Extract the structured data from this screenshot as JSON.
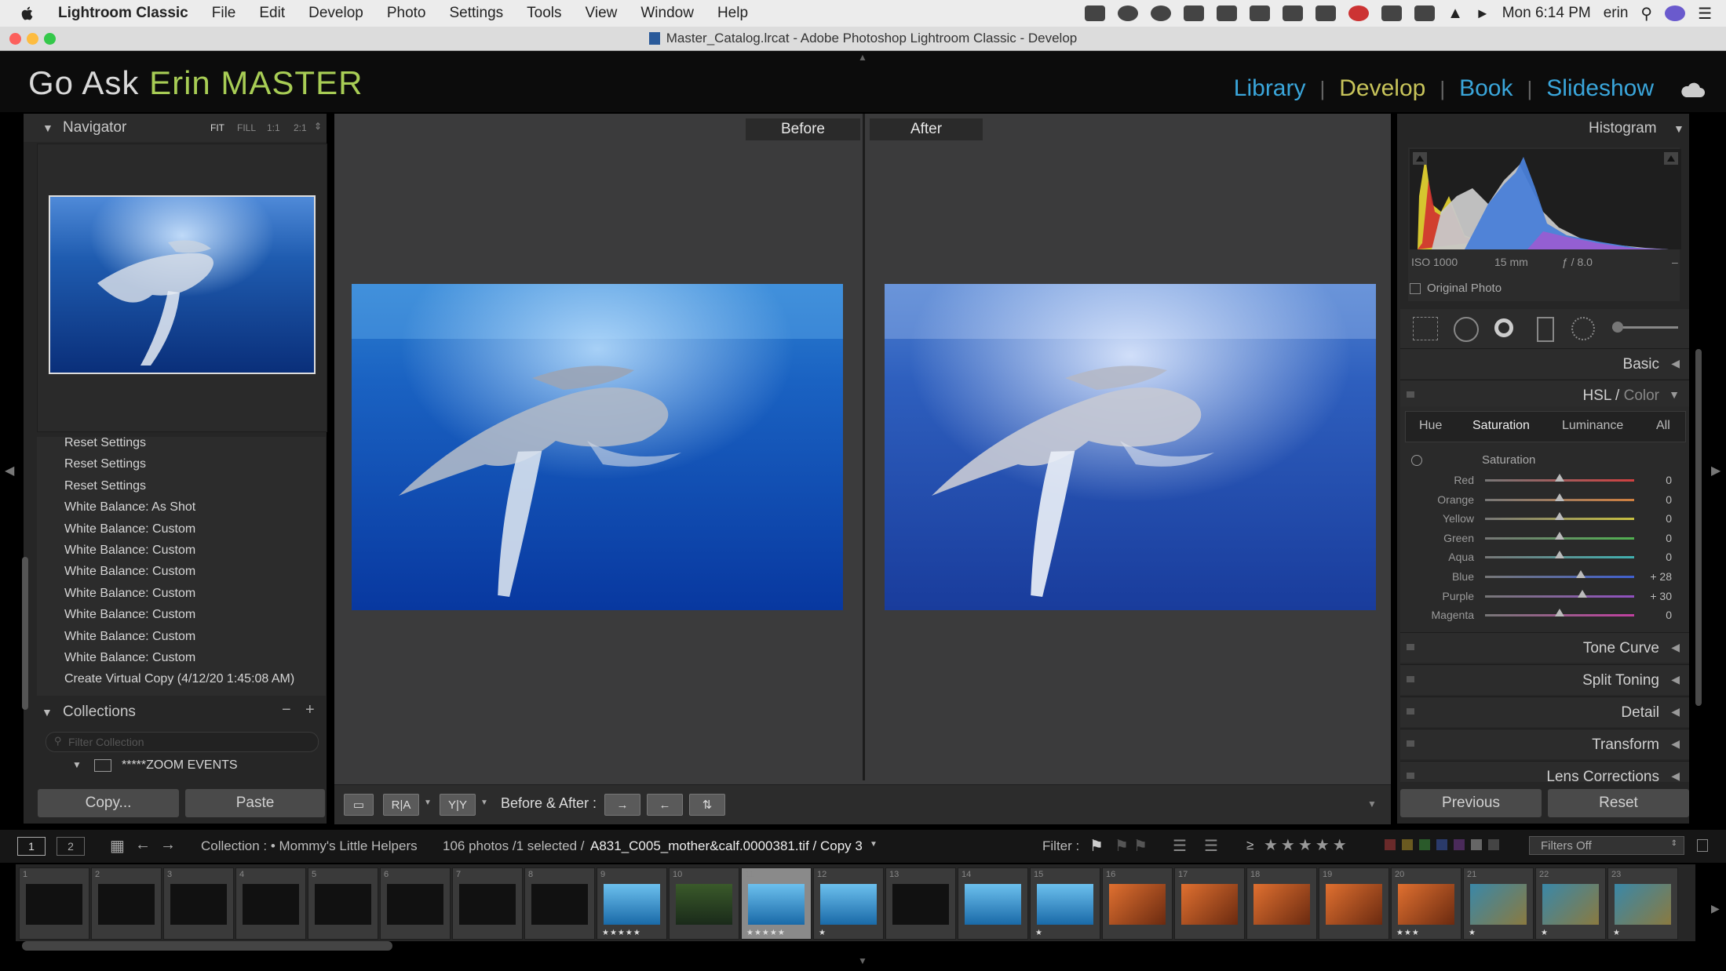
{
  "menubar": {
    "items": [
      "Lightroom Classic",
      "File",
      "Edit",
      "Develop",
      "Photo",
      "Settings",
      "Tools",
      "View",
      "Window",
      "Help"
    ],
    "clock": "Mon 6:14 PM",
    "user": "erin"
  },
  "window": {
    "title": "Master_Catalog.lrcat - Adobe Photoshop Lightroom Classic - Develop"
  },
  "identity": {
    "part1": "Go Ask ",
    "part2": "Erin MASTER"
  },
  "modules": [
    {
      "label": "Library",
      "active": false
    },
    {
      "label": "Develop",
      "active": true
    },
    {
      "label": "Book",
      "active": false
    },
    {
      "label": "Slideshow",
      "active": false
    }
  ],
  "navigator": {
    "title": "Navigator",
    "zoom": [
      "FIT",
      "FILL",
      "1:1",
      "2:1"
    ]
  },
  "history": [
    "Reset Settings",
    "Reset Settings",
    "Reset Settings",
    "White Balance: As Shot",
    "White Balance: Custom",
    "White Balance: Custom",
    "White Balance: Custom",
    "White Balance: Custom",
    "White Balance: Custom",
    "White Balance: Custom",
    "White Balance: Custom",
    "Create Virtual Copy (4/12/20 1:45:08 AM)"
  ],
  "collections": {
    "title": "Collections",
    "filter_placeholder": "Filter Collection",
    "item": "*****ZOOM EVENTS"
  },
  "left_buttons": {
    "copy": "Copy...",
    "paste": "Paste"
  },
  "view": {
    "before_label": "Before",
    "after_label": "After"
  },
  "toolbar": {
    "before_after_label": "Before & After :"
  },
  "histogram": {
    "title": "Histogram",
    "iso": "ISO 1000",
    "focal": "15 mm",
    "aperture": "ƒ / 8.0",
    "dash": "–",
    "original_photo": "Original Photo"
  },
  "sections": {
    "basic": "Basic",
    "hsl_a": "HSL",
    "hsl_b": "Color",
    "tone_curve": "Tone Curve",
    "split_toning": "Split Toning",
    "detail": "Detail",
    "transform": "Transform",
    "lens": "Lens Corrections"
  },
  "hsl": {
    "tabs": [
      "Hue",
      "Saturation",
      "Luminance",
      "All"
    ],
    "active_tab": "Saturation",
    "group_label": "Saturation",
    "sliders": [
      {
        "name": "Red",
        "value": "0",
        "pos": 0.5,
        "color": "#d04040"
      },
      {
        "name": "Orange",
        "value": "0",
        "pos": 0.5,
        "color": "#d08040"
      },
      {
        "name": "Yellow",
        "value": "0",
        "pos": 0.5,
        "color": "#c8c040"
      },
      {
        "name": "Green",
        "value": "0",
        "pos": 0.5,
        "color": "#50b050"
      },
      {
        "name": "Aqua",
        "value": "0",
        "pos": 0.5,
        "color": "#40b0b0"
      },
      {
        "name": "Blue",
        "value": "+ 28",
        "pos": 0.64,
        "color": "#4060d0"
      },
      {
        "name": "Purple",
        "value": "+ 30",
        "pos": 0.65,
        "color": "#9050c0"
      },
      {
        "name": "Magenta",
        "value": "0",
        "pos": 0.5,
        "color": "#c040a0"
      }
    ]
  },
  "right_buttons": {
    "previous": "Previous",
    "reset": "Reset"
  },
  "filmstrip_bar": {
    "page1": "1",
    "page2": "2",
    "collection": "Collection : • Mommy's Little Helpers",
    "count": "106 photos /1 selected /",
    "filename": "A831_C005_mother&calf.0000381.tif / Copy 3",
    "filter_label": "Filter :",
    "gte": "≥",
    "filters_off": "Filters Off"
  },
  "thumbs": [
    {
      "num": "1",
      "kind": "dark",
      "stars": ""
    },
    {
      "num": "2",
      "kind": "dark",
      "stars": ""
    },
    {
      "num": "3",
      "kind": "dark",
      "stars": ""
    },
    {
      "num": "4",
      "kind": "dark",
      "stars": ""
    },
    {
      "num": "5",
      "kind": "dark",
      "stars": ""
    },
    {
      "num": "6",
      "kind": "dark",
      "stars": ""
    },
    {
      "num": "7",
      "kind": "dark",
      "stars": ""
    },
    {
      "num": "8",
      "kind": "dark",
      "stars": ""
    },
    {
      "num": "9",
      "kind": "ocean",
      "stars": "★★★★★"
    },
    {
      "num": "10",
      "kind": "green",
      "stars": ""
    },
    {
      "num": "11",
      "kind": "ocean",
      "stars": "★★★★★"
    },
    {
      "num": "12",
      "kind": "ocean",
      "stars": "★"
    },
    {
      "num": "13",
      "kind": "dark",
      "stars": ""
    },
    {
      "num": "14",
      "kind": "ocean",
      "stars": ""
    },
    {
      "num": "15",
      "kind": "ocean",
      "stars": "★"
    },
    {
      "num": "16",
      "kind": "orange",
      "stars": ""
    },
    {
      "num": "17",
      "kind": "orange",
      "stars": ""
    },
    {
      "num": "18",
      "kind": "orange",
      "stars": ""
    },
    {
      "num": "19",
      "kind": "orange",
      "stars": ""
    },
    {
      "num": "20",
      "kind": "orange",
      "stars": "★★★"
    },
    {
      "num": "21",
      "kind": "reef",
      "stars": "★"
    },
    {
      "num": "22",
      "kind": "reef",
      "stars": "★"
    },
    {
      "num": "23",
      "kind": "reef",
      "stars": "★"
    }
  ],
  "colors": {
    "accent_blue": "#3aa6db",
    "accent_yellow": "#c8c45a",
    "brand_green": "#a8cd55"
  }
}
